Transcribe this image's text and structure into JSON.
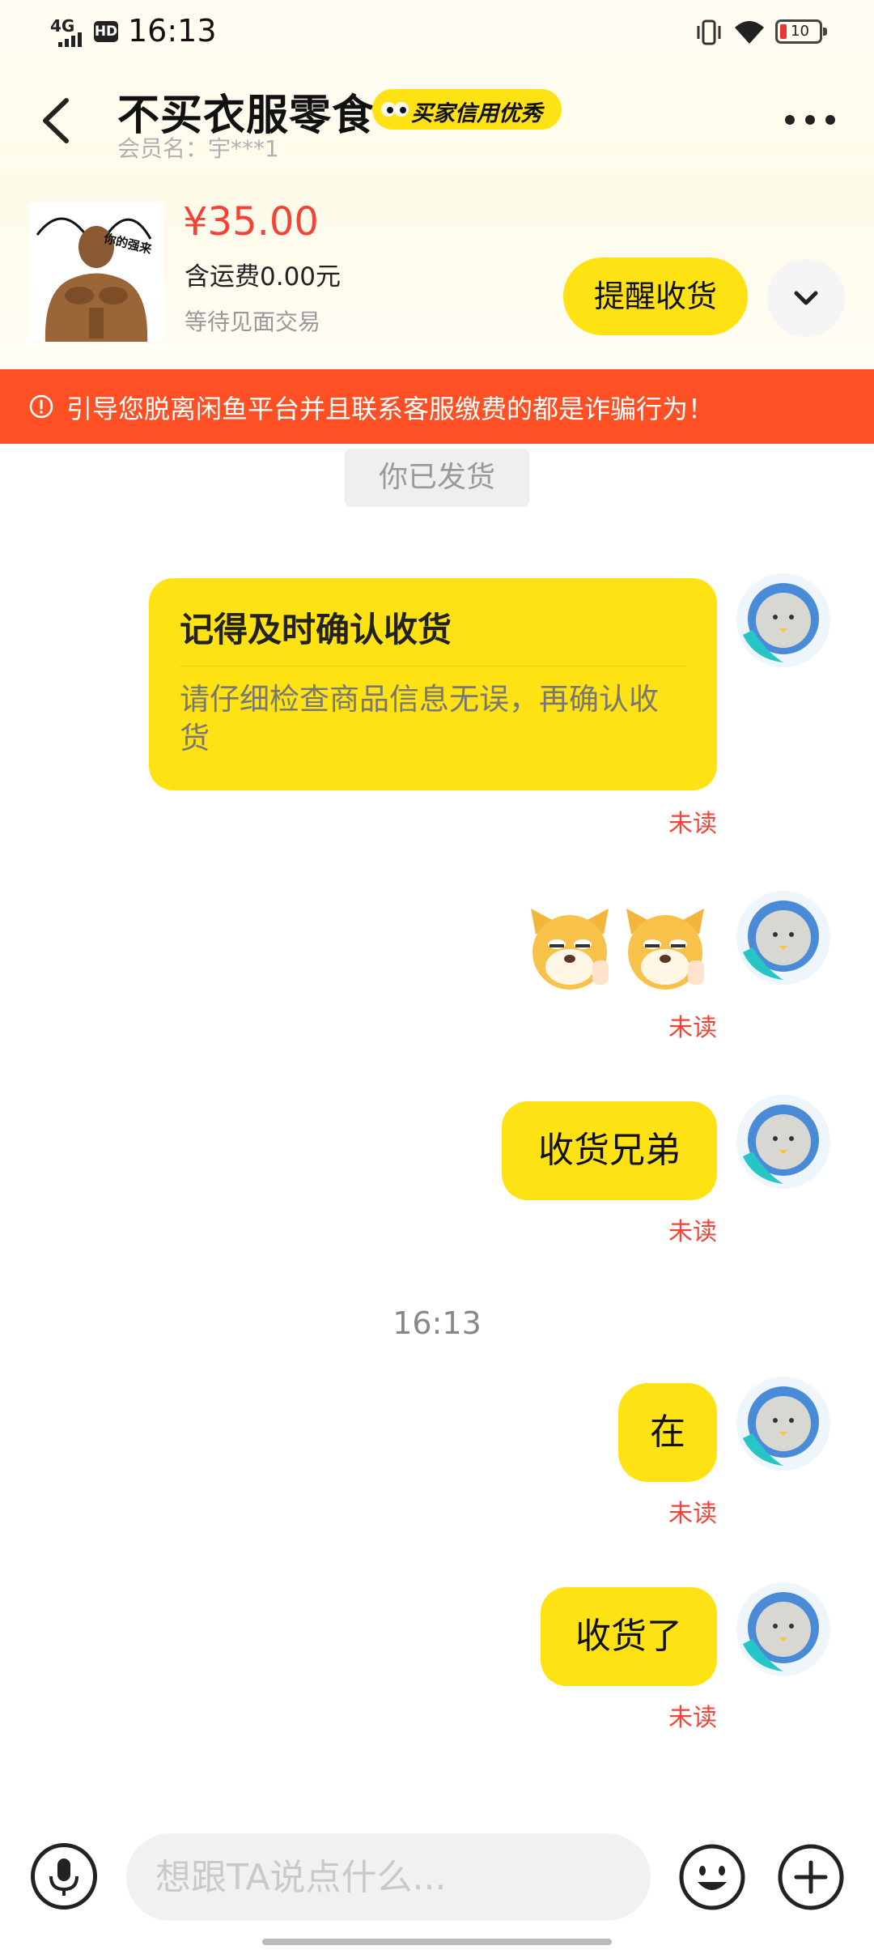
{
  "status_bar": {
    "network": "4G",
    "hd": "HD",
    "time": "16:13",
    "battery": "10"
  },
  "header": {
    "title": "不买衣服零食",
    "badge": "买家信用优秀",
    "member": "会员名：宇***1"
  },
  "product": {
    "thumb_text": "你的强来",
    "price": "¥35.00",
    "shipping": "含运费0.00元",
    "status": "等待见面交易",
    "remind_button": "提醒收货"
  },
  "warning": {
    "text": "引导您脱离闲鱼平台并且联系客服缴费的都是诈骗行为！"
  },
  "system_message": "你已发货",
  "messages": {
    "card": {
      "title": "记得及时确认收货",
      "body": "请仔细检查商品信息无误，再确认收货",
      "status": "未读"
    },
    "stickers": {
      "status": "未读"
    },
    "m1": {
      "text": "收货兄弟",
      "status": "未读"
    },
    "time_separator": "16:13",
    "m2": {
      "text": "在",
      "status": "未读"
    },
    "m3": {
      "text": "收货了",
      "status": "未读"
    }
  },
  "input": {
    "placeholder": "想跟TA说点什么..."
  },
  "icons": {
    "back": "chevron-left-icon",
    "more": "more-dots-icon",
    "expand": "chevron-down-icon",
    "warning": "alert-circle-icon",
    "mic": "microphone-icon",
    "emoji": "smile-icon",
    "plus": "plus-icon"
  },
  "colors": {
    "accent_yellow": "#ffe213",
    "warning_red": "#ff5025",
    "price_red": "#f44336",
    "unread_red": "#f44336"
  }
}
